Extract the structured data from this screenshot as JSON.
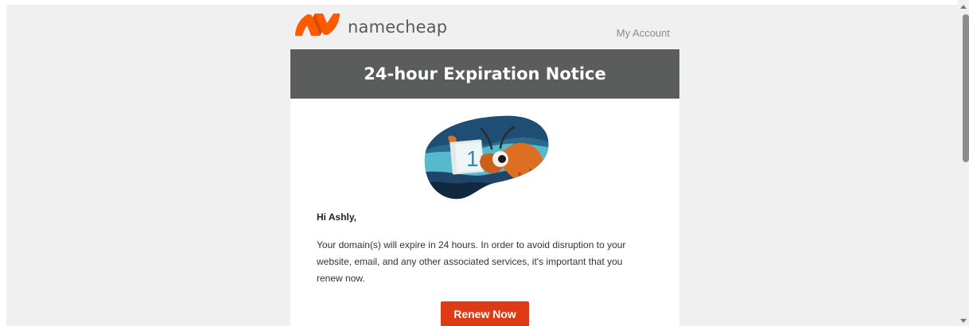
{
  "header": {
    "brand_name": "namecheap",
    "my_account": "My Account"
  },
  "banner": {
    "title": "24-hour Expiration Notice"
  },
  "hero": {
    "card_number": "1"
  },
  "message": {
    "greeting": "Hi Ashly,",
    "body": "Your domain(s) will expire in 24 hours. In order to avoid disruption to your website, email, and any other associated services, it's important that you renew now."
  },
  "cta": {
    "label": "Renew Now"
  },
  "colors": {
    "brand_orange": "#ff5a00",
    "banner_gray": "#5a5d5c",
    "cta_red": "#de3a16"
  },
  "icons": {
    "logo": "namecheap-logo-icon",
    "hero": "ant-mascot-illustration",
    "scroll_up": "scroll-up-icon",
    "scroll_down": "scroll-down-icon"
  }
}
